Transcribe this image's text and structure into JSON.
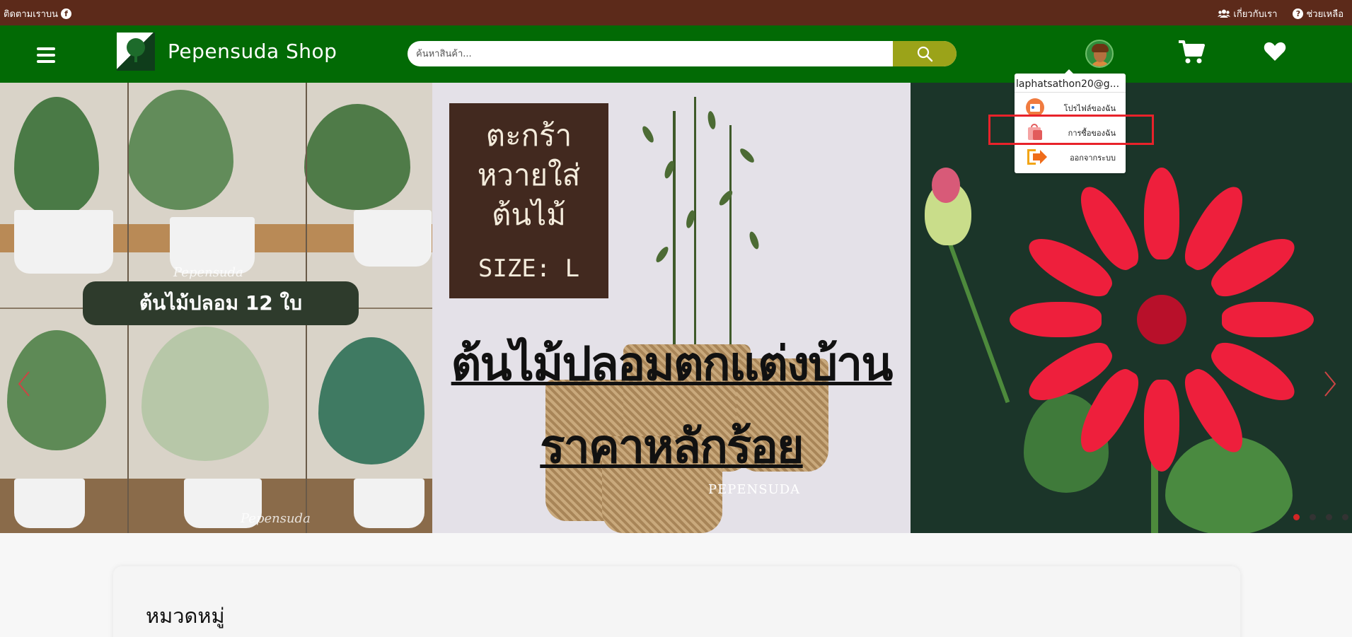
{
  "topbar": {
    "follow_label": "ติดตามเราบน",
    "about_label": "เกี่ยวกับเรา",
    "help_label": "ช่วยเหลือ"
  },
  "header": {
    "brand": "Pepensuda Shop",
    "search_placeholder": "ค้นหาสินค้า...",
    "logo_text": "Pepensuda"
  },
  "user_menu": {
    "email": "laphatsathon20@g...",
    "items": [
      {
        "label": "โปรไฟล์ของฉัน",
        "icon": "profile-card-icon"
      },
      {
        "label": "การซื้อของฉัน",
        "icon": "shopping-bag-icon"
      },
      {
        "label": "ออกจากระบบ",
        "icon": "logout-icon"
      }
    ],
    "highlighted_index": 1
  },
  "carousel": {
    "slide_1": {
      "banner_text": "ต้นไม้ปลอม 12 ใบ",
      "watermark": "Pepensuda"
    },
    "slide_2": {
      "box_text": "ตะกร้า\nหวายใส่\nต้นไม้",
      "box_size": "SIZE: L",
      "headline_1": "ต้นไม้ปลอมตกแต่งบ้าน",
      "headline_2": "ราคาหลักร้อย",
      "watermark": "PEPENSUDA"
    },
    "dot_count": 4,
    "active_dot": 0
  },
  "categories": {
    "title": "หมวดหมู่"
  },
  "colors": {
    "topbar": "#5c2a1a",
    "header": "#026a05",
    "search_button": "#9ba319",
    "highlight": "#e8222a",
    "active_dot": "#d32525"
  }
}
